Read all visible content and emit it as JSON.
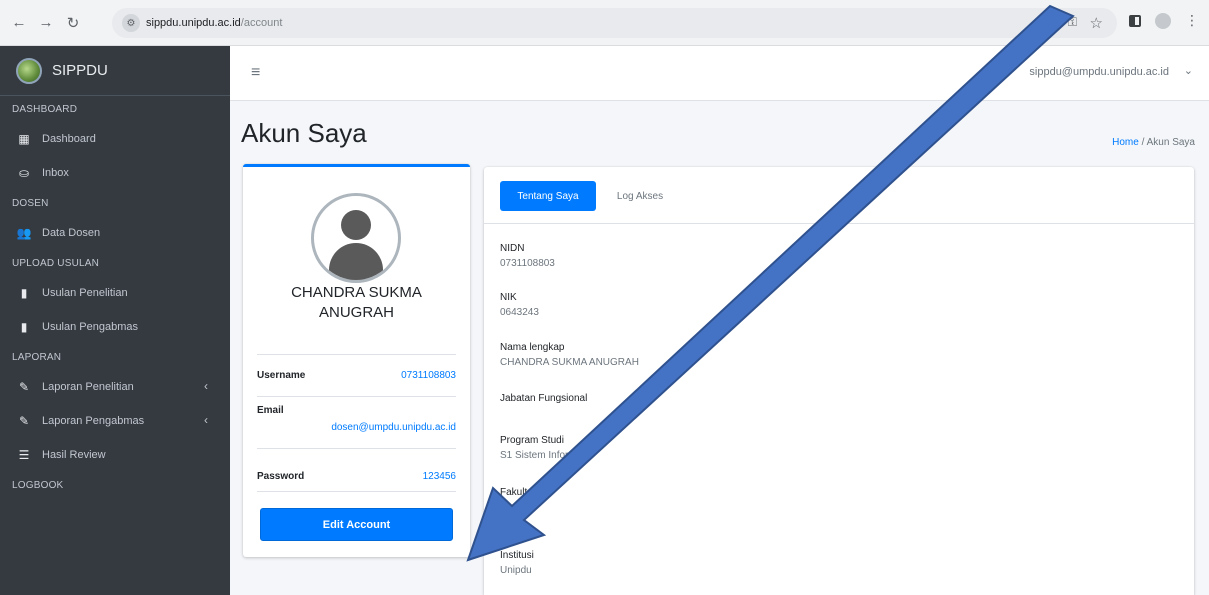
{
  "browser": {
    "url_host": "sippdu.unipdu.ac.id",
    "url_path": "/account"
  },
  "sidebar": {
    "brand": "SIPPDU",
    "sections": [
      {
        "header": "DASHBOARD",
        "items": [
          {
            "label": "Dashboard",
            "icon": "grid-icon"
          },
          {
            "label": "Inbox",
            "icon": "inbox-icon"
          }
        ]
      },
      {
        "header": "DOSEN",
        "items": [
          {
            "label": "Data Dosen",
            "icon": "users-icon"
          }
        ]
      },
      {
        "header": "UPLOAD USULAN",
        "items": [
          {
            "label": "Usulan Penelitian",
            "icon": "file-icon"
          },
          {
            "label": "Usulan Pengabmas",
            "icon": "file-icon"
          }
        ]
      },
      {
        "header": "LAPORAN",
        "items": [
          {
            "label": "Laporan Penelitian",
            "icon": "edit-icon",
            "caret": "‹"
          },
          {
            "label": "Laporan Pengabmas",
            "icon": "edit-icon",
            "caret": "‹"
          },
          {
            "label": "Hasil Review",
            "icon": "list-icon"
          }
        ]
      },
      {
        "header": "LOGBOOK",
        "items": []
      }
    ]
  },
  "topbar": {
    "user_email": "sippdu@umpdu.unipdu.ac.id"
  },
  "content": {
    "title": "Akun Saya",
    "breadcrumb": {
      "home": "Home",
      "separator": "/",
      "current": "Akun Saya"
    }
  },
  "profile": {
    "name": "CHANDRA SUKMA ANUGRAH",
    "username_label": "Username",
    "username_value": "0731108803",
    "email_label": "Email",
    "email_value": "dosen@umpdu.unipdu.ac.id",
    "password_label": "Password",
    "password_value": "123456",
    "edit_button": "Edit Account"
  },
  "details": {
    "tabs": [
      "Tentang Saya",
      "Log Akses"
    ],
    "fields": [
      {
        "label": "NIDN",
        "value": "0731108803"
      },
      {
        "label": "NIK",
        "value": "0643243"
      },
      {
        "label": "Nama lengkap",
        "value": "CHANDRA SUKMA ANUGRAH"
      },
      {
        "label": "Jabatan Fungsional",
        "value": ""
      },
      {
        "label": "Program Studi",
        "value": "S1 Sistem Informasi"
      },
      {
        "label": "Fakultas",
        "value": "-"
      },
      {
        "label": "Institusi",
        "value": "Unipdu"
      }
    ]
  },
  "colors": {
    "primary": "#007bff",
    "sidebar_bg": "#343a40",
    "arrow_fill": "#4472c4",
    "arrow_stroke": "#2f528f"
  }
}
